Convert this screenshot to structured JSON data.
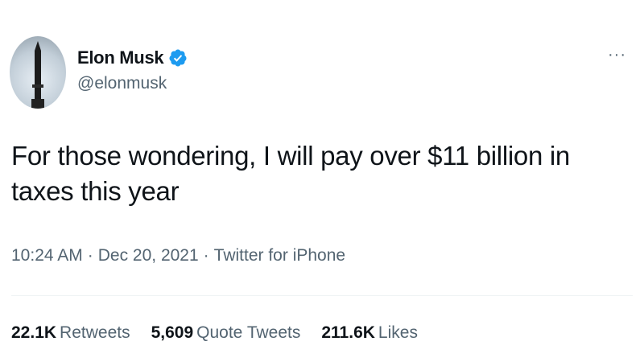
{
  "author": {
    "name": "Elon Musk",
    "handle": "@elonmusk",
    "verified": true
  },
  "tweet": {
    "text": "For those wondering, I will pay over $11 billion in taxes this year",
    "time": "10:24 AM",
    "date": "Dec 20, 2021",
    "source": "Twitter for iPhone",
    "separator": "·"
  },
  "stats": {
    "retweets_count": "22.1K",
    "retweets_label": "Retweets",
    "quote_count": "5,609",
    "quote_label": "Quote Tweets",
    "likes_count": "211.6K",
    "likes_label": "Likes"
  },
  "icons": {
    "verified": "verified-badge-icon",
    "more": "more-options-icon"
  },
  "colors": {
    "text_primary": "#0f1419",
    "text_secondary": "#536471",
    "verified_blue": "#1d9bf0"
  }
}
